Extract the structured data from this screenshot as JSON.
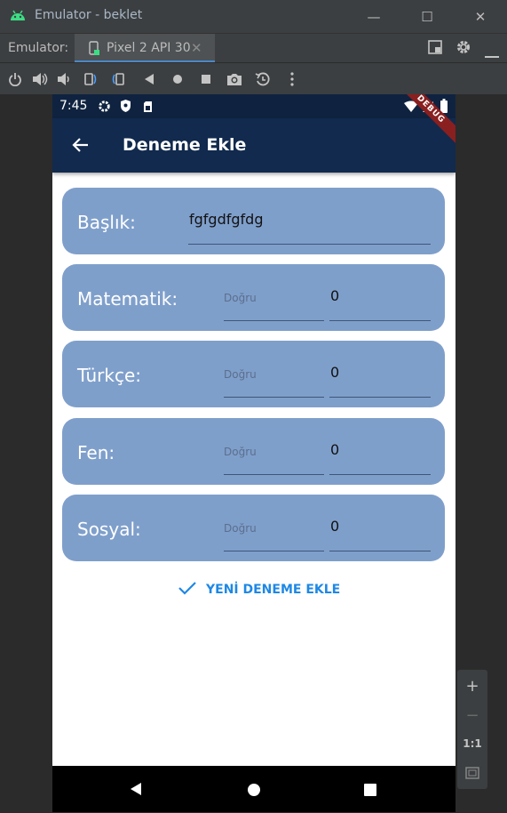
{
  "window": {
    "title": "Emulator - beklet",
    "minimize": "—",
    "maximize": "☐",
    "close": "✕"
  },
  "tabbar": {
    "label": "Emulator:",
    "tab_name": "Pixel 2 API 30",
    "tab_close": "✕"
  },
  "status": {
    "time": "7:45",
    "debug": "DEBUG"
  },
  "appbar": {
    "title": "Deneme Ekle"
  },
  "form": {
    "title_label": "Başlık:",
    "title_value": "fgfgdfgfdg",
    "subjects": [
      {
        "label": "Matematik:",
        "placeholder": "Doğru",
        "value": "0"
      },
      {
        "label": "Türkçe:",
        "placeholder": "Doğru",
        "value": "0"
      },
      {
        "label": "Fen:",
        "placeholder": "Doğru",
        "value": "0"
      },
      {
        "label": "Sosyal:",
        "placeholder": "Doğru",
        "value": "0"
      }
    ],
    "add_button": "YENİ DENEME EKLE"
  },
  "zoom": {
    "plus": "+",
    "minus": "−",
    "one_to_one": "1:1"
  },
  "colors": {
    "ide_bg": "#3c3f41",
    "appbar": "#112a4e",
    "card": "#7f9fcb",
    "accent": "#1e88e5"
  }
}
